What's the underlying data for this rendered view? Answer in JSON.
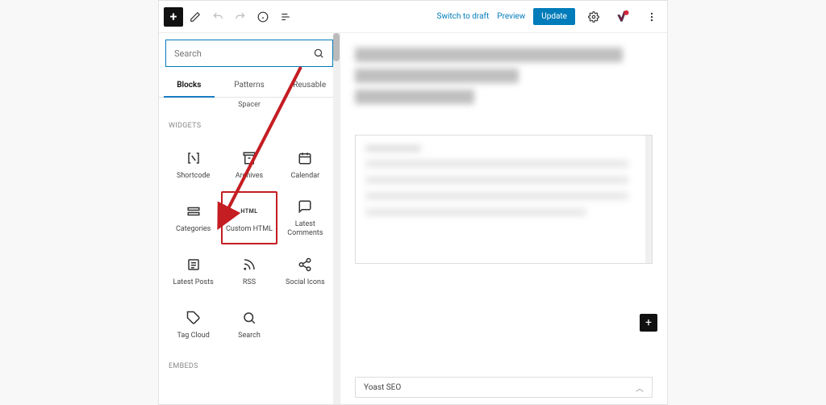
{
  "topbar": {
    "switch_draft": "Switch to draft",
    "preview": "Preview",
    "update": "Update"
  },
  "inserter": {
    "search_placeholder": "Search",
    "tabs": [
      {
        "key": "blocks",
        "label": "Blocks",
        "active": true
      },
      {
        "key": "patterns",
        "label": "Patterns",
        "active": false
      },
      {
        "key": "reusable",
        "label": "Reusable",
        "active": false
      }
    ],
    "small_label": "Spacer",
    "section_widgets": "WIDGETS",
    "section_embeds": "EMBEDS",
    "widgets": [
      {
        "key": "shortcode",
        "label": "Shortcode",
        "icon": "shortcode"
      },
      {
        "key": "archives",
        "label": "Archives",
        "icon": "archives"
      },
      {
        "key": "calendar",
        "label": "Calendar",
        "icon": "calendar"
      },
      {
        "key": "categories",
        "label": "Categories",
        "icon": "categories"
      },
      {
        "key": "custom-html",
        "label": "Custom HTML",
        "icon": "html",
        "highlight": true
      },
      {
        "key": "latest-comments",
        "label": "Latest Comments",
        "icon": "comment"
      },
      {
        "key": "latest-posts",
        "label": "Latest Posts",
        "icon": "posts"
      },
      {
        "key": "rss",
        "label": "RSS",
        "icon": "rss"
      },
      {
        "key": "social-icons",
        "label": "Social Icons",
        "icon": "share"
      },
      {
        "key": "tag-cloud",
        "label": "Tag Cloud",
        "icon": "tag"
      },
      {
        "key": "search",
        "label": "Search",
        "icon": "search"
      }
    ]
  },
  "content": {
    "metabox_title": "Yoast SEO"
  },
  "icons": {
    "plus": "+",
    "pencil": "pencil",
    "undo": "undo",
    "redo": "redo",
    "info": "info",
    "tree": "tree",
    "gear": "gear",
    "yoast": "yoast",
    "kebab": "kebab",
    "magnify": "magnify"
  }
}
